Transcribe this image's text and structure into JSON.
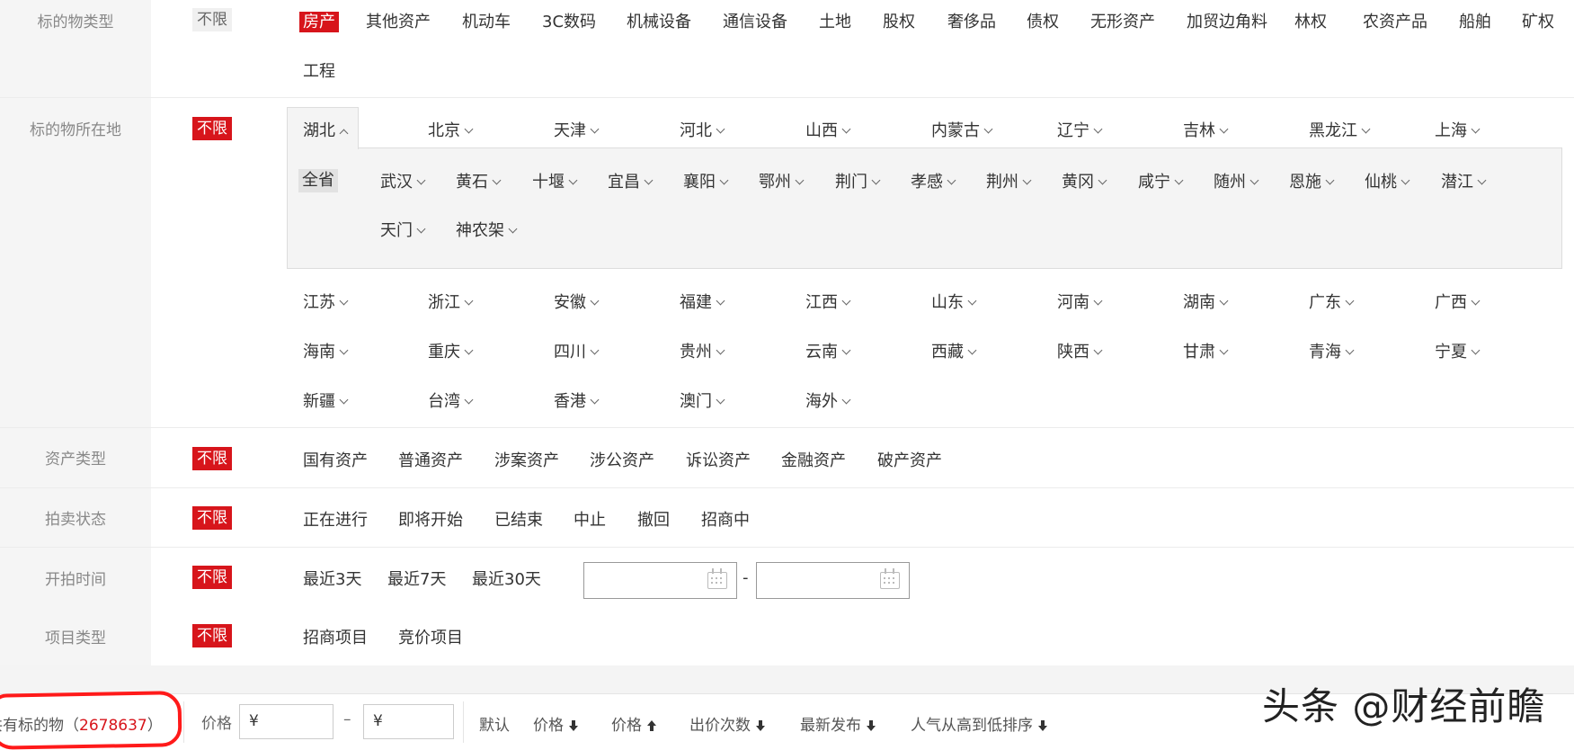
{
  "filters": {
    "asset_type": {
      "label": "标的物类型",
      "no_limit": "不限",
      "options": [
        "房产",
        "其他资产",
        "机动车",
        "3C数码",
        "机械设备",
        "通信设备",
        "土地",
        "股权",
        "奢侈品",
        "债权",
        "无形资产",
        "加贸边角料",
        "林权",
        "农资产品",
        "船舶",
        "矿权",
        "工程"
      ],
      "selected": "房产"
    },
    "location": {
      "label": "标的物所在地",
      "no_limit": "不限",
      "provinces_row1": [
        "湖北",
        "北京",
        "天津",
        "河北",
        "山西",
        "内蒙古",
        "辽宁",
        "吉林",
        "黑龙江",
        "上海"
      ],
      "expanded_province": "湖北",
      "all_province": "全省",
      "cities": [
        "武汉",
        "黄石",
        "十堰",
        "宜昌",
        "襄阳",
        "鄂州",
        "荆门",
        "孝感",
        "荆州",
        "黄冈",
        "咸宁",
        "随州",
        "恩施",
        "仙桃",
        "潜江",
        "天门",
        "神农架"
      ],
      "provinces_row2": [
        "江苏",
        "浙江",
        "安徽",
        "福建",
        "江西",
        "山东",
        "河南",
        "湖南",
        "广东",
        "广西"
      ],
      "provinces_row3": [
        "海南",
        "重庆",
        "四川",
        "贵州",
        "云南",
        "西藏",
        "陕西",
        "甘肃",
        "青海",
        "宁夏"
      ],
      "provinces_row4": [
        "新疆",
        "台湾",
        "香港",
        "澳门",
        "海外"
      ]
    },
    "asset_class": {
      "label": "资产类型",
      "no_limit": "不限",
      "options": [
        "国有资产",
        "普通资产",
        "涉案资产",
        "涉公资产",
        "诉讼资产",
        "金融资产",
        "破产资产"
      ]
    },
    "auction_status": {
      "label": "拍卖状态",
      "no_limit": "不限",
      "options": [
        "正在进行",
        "即将开始",
        "已结束",
        "中止",
        "撤回",
        "招商中"
      ]
    },
    "start_time": {
      "label": "开拍时间",
      "no_limit": "不限",
      "options": [
        "最近3天",
        "最近7天",
        "最近30天"
      ],
      "range_separator": "-"
    },
    "project_type": {
      "label": "项目类型",
      "no_limit": "不限",
      "options": [
        "招商项目",
        "竞价项目"
      ]
    }
  },
  "result_bar": {
    "total_prefix": "共有标的物（",
    "total_count": "2678637",
    "total_suffix": "）",
    "price_label": "价格",
    "price_min_placeholder": "¥",
    "price_range_sep": "–",
    "price_max_placeholder": "¥",
    "sorts": [
      "默认",
      "价格",
      "价格",
      "出价次数",
      "最新发布",
      "人气从高到低排序"
    ]
  },
  "watermark": "头条 @财经前瞻",
  "colors": {
    "accent": "#d7151b",
    "label_bg": "#f5f5f5",
    "panel_bg": "#f4f4f4"
  }
}
